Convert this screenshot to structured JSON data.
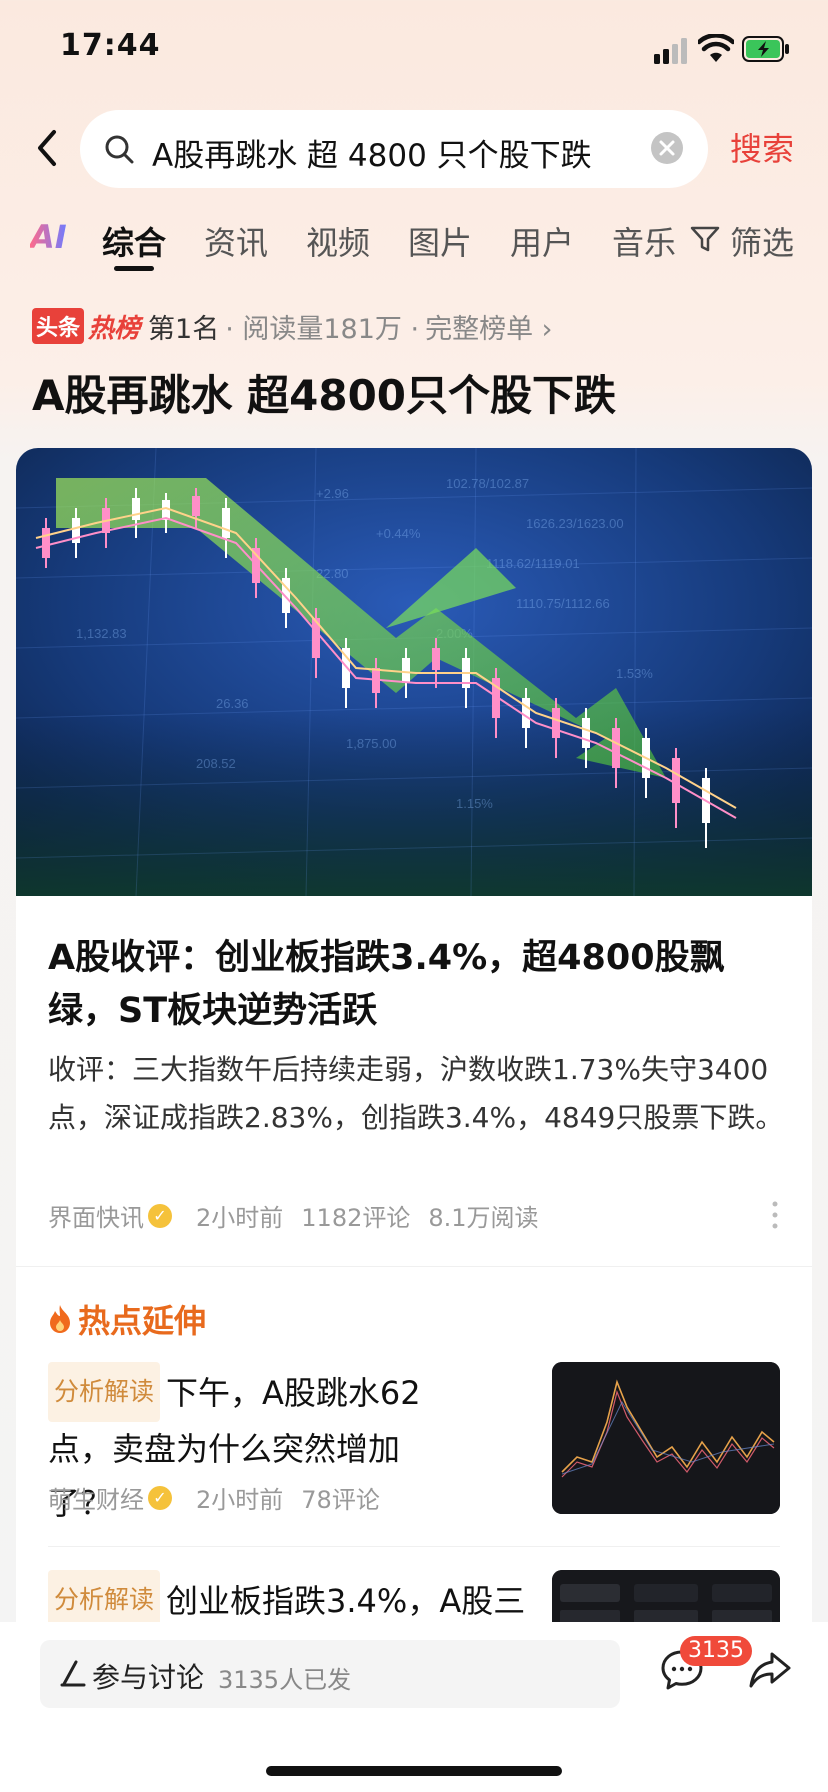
{
  "status_bar": {
    "time": "17:44"
  },
  "search": {
    "query": "A股再跳水 超 4800 只个股下跌",
    "submit_label": "搜索"
  },
  "tabs": [
    {
      "label": "AI"
    },
    {
      "label": "综合"
    },
    {
      "label": "资讯"
    },
    {
      "label": "视频"
    },
    {
      "label": "图片"
    },
    {
      "label": "用户"
    },
    {
      "label": "音乐"
    },
    {
      "label": "筛选"
    }
  ],
  "hot_rank": {
    "badge_toutiao": "头条",
    "badge_hot": "热榜",
    "rank": "第1名",
    "reads": "· 阅读量181万 ·",
    "full_list": "完整榜单 ›"
  },
  "headline": "A股再跳水 超4800只个股下跌",
  "article": {
    "title": "A股收评：创业板指跌3.4%，超4800股飘绿，ST板块逆势活跃",
    "summary": "收评：三大指数午后持续走弱，沪数收跌1.73%失守3400点，深证成指跌2.83%，创指跌3.4%，4849只股票下跌。",
    "source": "界面快讯",
    "time": "2小时前",
    "comments": "1182评论",
    "reads": "8.1万阅读"
  },
  "hot_extension": {
    "label": "热点延伸",
    "items": [
      {
        "tag": "分析解读",
        "title": "下午，A股跳水62点，卖盘为什么突然增加了？",
        "source": "萌生财经",
        "time": "2小时前",
        "comments": "78评论"
      },
      {
        "tag": "分析解读",
        "title": "创业板指跌3.4%，A股三"
      }
    ]
  },
  "bottom_bar": {
    "comment_label": "参与讨论",
    "comment_count": "3135人已发",
    "badge": "3135"
  },
  "colors": {
    "accent": "#e8413a",
    "hot_ext": "#e86a1d",
    "tag_bg": "#fcf1e3",
    "tag_text": "#d08b3c"
  }
}
